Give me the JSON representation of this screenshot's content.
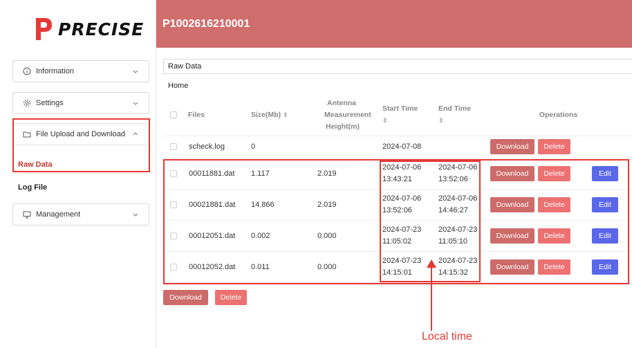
{
  "brand": {
    "name": "PRECISE",
    "color": "#e53935"
  },
  "header": {
    "title": "P1002616210001",
    "bg_color": "#cf6e6c"
  },
  "sidebar": {
    "menus": [
      {
        "label": "Information",
        "icon": "info-icon"
      },
      {
        "label": "Settings",
        "icon": "gear-icon"
      },
      {
        "label": "File Upload and Download",
        "icon": "folder-icon",
        "expanded": true
      },
      {
        "label": "Management",
        "icon": "monitor-icon"
      }
    ],
    "subitems": [
      {
        "label": "Raw Data",
        "active": true,
        "color": "#c0392b"
      },
      {
        "label": "Log File",
        "active": false
      }
    ]
  },
  "content": {
    "section_title": "Raw Data",
    "breadcrumb": "Home",
    "columns": {
      "files": "Files",
      "size": "Size(Mb)",
      "antenna_1": "Antenna",
      "antenna_2": "Measurement",
      "antenna_3": "Height(m)",
      "start": "Start Time",
      "end": "End Time",
      "operations": "Operations"
    },
    "sort_glyph": "⇕",
    "rows": [
      {
        "file": "scheck.log",
        "size": "0",
        "antenna": "",
        "start_date": "2024-07-08",
        "start_time": "",
        "end_date": "",
        "end_time": "",
        "editable": false
      },
      {
        "file": "00011881.dat",
        "size": "1.117",
        "antenna": "2.019",
        "start_date": "2024-07-06",
        "start_time": "13:43:21",
        "end_date": "2024-07-06",
        "end_time": "13:52:06",
        "editable": true
      },
      {
        "file": "00021881.dat",
        "size": "14.866",
        "antenna": "2.019",
        "start_date": "2024-07-06",
        "start_time": "13:52:06",
        "end_date": "2024-07-06",
        "end_time": "14:46:27",
        "editable": true
      },
      {
        "file": "00012051.dat",
        "size": "0.002",
        "antenna": "0.000",
        "start_date": "2024-07-23",
        "start_time": "11:05:02",
        "end_date": "2024-07-23",
        "end_time": "11:05:10",
        "editable": true
      },
      {
        "file": "00012052.dat",
        "size": "0.011",
        "antenna": "0.000",
        "start_date": "2024-07-23",
        "start_time": "14:15:01",
        "end_date": "2024-07-23",
        "end_time": "14:15:32",
        "editable": true
      }
    ],
    "buttons": {
      "download": "Download",
      "delete": "Delete",
      "edit": "Edit"
    },
    "button_colors": {
      "download": "#cd6b6a",
      "delete": "#ec7171",
      "edit": "#5a67e8"
    }
  },
  "annotation": {
    "label": "Local time",
    "color": "#e53935"
  }
}
